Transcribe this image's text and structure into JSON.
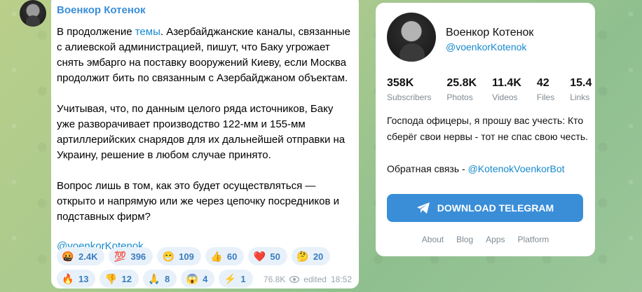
{
  "message": {
    "author": "Военкор Котенок",
    "paragraph1_before_link": "В продолжение ",
    "paragraph1_link": "темы",
    "paragraph1_after_link": ". Азербайджанские каналы, связанные с алиевской администрацией, пишут, что Баку угрожает снять эмбарго на поставку вооружений Киеву, если Москва продолжит бить по связанным с Азербайджаном объектам.",
    "paragraph2": "Учитывая, что, по данным целого ряда источников, Баку уже разворачивает производство 122-мм и 155-мм артиллерийских снарядов для их дальнейшей отправки на Украину, решение в любом случае принято.",
    "paragraph3": "Вопрос лишь в том, как это будет осуществляться — открыто и напрямую или же через цепочку посредников и подставных фирм?",
    "signature": "@voenkorKotenok",
    "reactions_row1": [
      {
        "emoji": "🤬",
        "count": "2.4K"
      },
      {
        "emoji": "💯",
        "count": "396"
      },
      {
        "emoji": "😁",
        "count": "109"
      },
      {
        "emoji": "👍",
        "count": "60"
      },
      {
        "emoji": "❤️",
        "count": "50"
      },
      {
        "emoji": "🤔",
        "count": "20"
      }
    ],
    "reactions_row2": [
      {
        "emoji": "🔥",
        "count": "13"
      },
      {
        "emoji": "👎",
        "count": "12"
      },
      {
        "emoji": "🙏",
        "count": "8"
      },
      {
        "emoji": "😱",
        "count": "4"
      },
      {
        "emoji": "⚡",
        "count": "1"
      }
    ],
    "views": "76.8K",
    "edited_label": "edited",
    "time": "18:52"
  },
  "channel": {
    "title": "Военкор Котенок",
    "handle": "@voenkorKotenok",
    "stats": [
      {
        "value": "358K",
        "label": "Subscribers"
      },
      {
        "value": "25.8K",
        "label": "Photos"
      },
      {
        "value": "11.4K",
        "label": "Videos"
      },
      {
        "value": "42",
        "label": "Files"
      },
      {
        "value": "15.4",
        "label": "Links"
      }
    ],
    "description_line1": "Господа офицеры, я прошу вас учесть: Кто сберёг свои нервы - тот не спас свою честь.",
    "feedback_prefix": "Обратная связь - ",
    "feedback_link": "@KotenokVoenkorBot",
    "download_label": "DOWNLOAD TELEGRAM",
    "footer_links": [
      "About",
      "Blog",
      "Apps",
      "Platform"
    ]
  },
  "colors": {
    "accent": "#3a8ed8",
    "link": "#168acd",
    "reaction_bg": "#e8f1fa"
  },
  "icons": {
    "telegram": "paper-plane-icon",
    "views": "eye-icon"
  }
}
